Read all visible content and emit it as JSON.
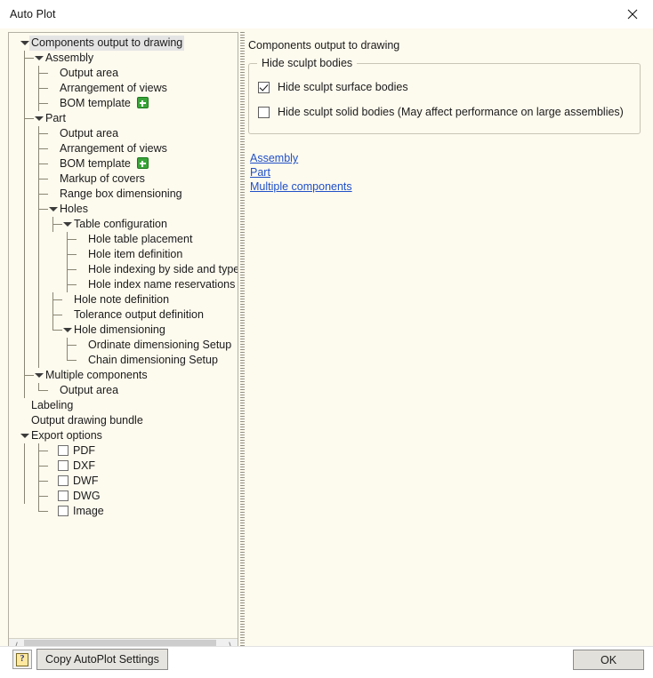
{
  "window": {
    "title": "Auto Plot",
    "close_icon": "close-icon"
  },
  "tree": {
    "nodes": [
      {
        "label": "Components output to drawing",
        "depth": 0,
        "expander": true,
        "selected": true
      },
      {
        "label": "Assembly",
        "depth": 1,
        "expander": true
      },
      {
        "label": "Output area",
        "depth": 2
      },
      {
        "label": "Arrangement of views",
        "depth": 2
      },
      {
        "label": "BOM template",
        "depth": 2,
        "badge": "plus-badge-icon"
      },
      {
        "label": "Part",
        "depth": 1,
        "expander": true
      },
      {
        "label": "Output area",
        "depth": 2
      },
      {
        "label": "Arrangement of views",
        "depth": 2
      },
      {
        "label": "BOM template",
        "depth": 2,
        "badge": "plus-badge-icon"
      },
      {
        "label": "Markup of covers",
        "depth": 2
      },
      {
        "label": "Range box dimensioning",
        "depth": 2
      },
      {
        "label": "Holes",
        "depth": 2,
        "expander": true
      },
      {
        "label": "Table configuration",
        "depth": 3,
        "expander": true
      },
      {
        "label": "Hole table placement",
        "depth": 4
      },
      {
        "label": "Hole item definition",
        "depth": 4
      },
      {
        "label": "Hole indexing by side and type",
        "depth": 4
      },
      {
        "label": "Hole index name reservations",
        "depth": 4
      },
      {
        "label": "Hole note definition",
        "depth": 3
      },
      {
        "label": "Tolerance output definition",
        "depth": 3
      },
      {
        "label": "Hole dimensioning",
        "depth": 3,
        "expander": true
      },
      {
        "label": "Ordinate dimensioning Setup",
        "depth": 4
      },
      {
        "label": "Chain dimensioning Setup",
        "depth": 4
      },
      {
        "label": "Multiple components",
        "depth": 1,
        "expander": true
      },
      {
        "label": "Output area",
        "depth": 2
      },
      {
        "label": "Labeling",
        "depth": 0
      },
      {
        "label": "Output drawing bundle",
        "depth": 0
      },
      {
        "label": "Export options",
        "depth": 0,
        "expander": true
      },
      {
        "label": "PDF",
        "depth": 2,
        "checkbox": false
      },
      {
        "label": "DXF",
        "depth": 2,
        "checkbox": false
      },
      {
        "label": "DWF",
        "depth": 2,
        "checkbox": false
      },
      {
        "label": "DWG",
        "depth": 2,
        "checkbox": false
      },
      {
        "label": "Image",
        "depth": 2,
        "checkbox": false
      }
    ],
    "scrollbar": {
      "left_arrow": "chevron-left-icon",
      "right_arrow": "chevron-right-icon"
    }
  },
  "panel": {
    "title": "Components output to drawing",
    "group": {
      "legend": "Hide sculpt bodies",
      "checkboxes": [
        {
          "label": "Hide sculpt surface bodies",
          "checked": true
        },
        {
          "label": "Hide sculpt solid bodies (May affect performance on large assemblies)",
          "checked": false
        }
      ]
    },
    "links": [
      "Assembly",
      "Part",
      "Multiple components"
    ]
  },
  "footer": {
    "help_label": "?",
    "copy_label": "Copy AutoPlot Settings",
    "ok_label": "OK"
  },
  "colors": {
    "panel_background": "#fdfaee",
    "link": "#2050c8",
    "badge_green": "#3aa33a",
    "selection": "#e4e4e4"
  }
}
